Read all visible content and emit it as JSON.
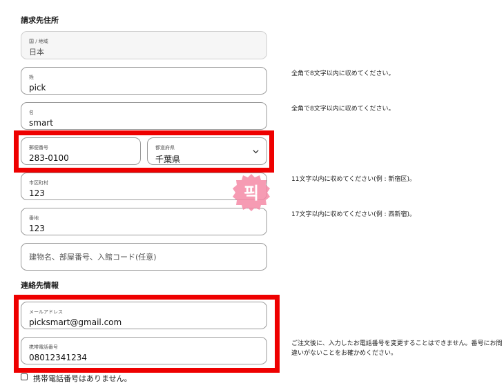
{
  "billing": {
    "heading": "請求先住所",
    "country": {
      "label": "国 / 地域",
      "value": "日本"
    },
    "last_name": {
      "label": "姓",
      "value": "pick",
      "hint": "全角で8文字以内に収めてください。"
    },
    "first_name": {
      "label": "名",
      "value": "smart",
      "hint": "全角で8文字以内に収めてください。"
    },
    "postal_code": {
      "label": "郵便番号",
      "value": "283-0100"
    },
    "prefecture": {
      "label": "都道府県",
      "value": "千葉県"
    },
    "city": {
      "label": "市区町村",
      "value": "123",
      "hint": "11文字以内に収めてください(例 : 新宿区)。"
    },
    "address": {
      "label": "番地",
      "value": "123",
      "hint": "17文字以内に収めてください(例 : 西新宿)。"
    },
    "building": {
      "placeholder": "建物名、部屋番号、入館コード(任意)"
    }
  },
  "contact": {
    "heading": "連絡先情報",
    "email": {
      "label": "メールアドレス",
      "value": "picksmart@gmail.com"
    },
    "mobile": {
      "label": "携帯電話番号",
      "value": "08012341234",
      "hint_line1": "ご注文後に、入力したお電話番号を変更することはできません。番号にお間",
      "hint_line2": "違いがないことをお確かめください。"
    },
    "no_mobile_label": "携帯電話番号はありません。"
  },
  "watermark": {
    "text": "픽",
    "color": "#f48aa6"
  },
  "colors": {
    "highlight": "#ee0000"
  }
}
